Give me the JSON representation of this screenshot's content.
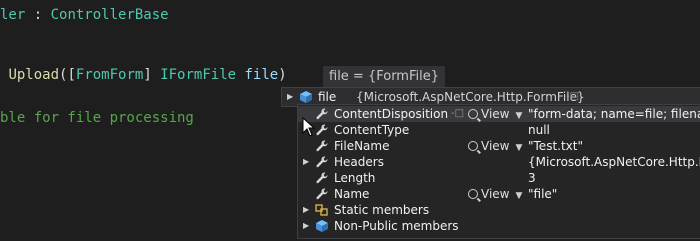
{
  "code": {
    "line1": {
      "class_suffix": "ler",
      "colon": " : ",
      "base": "ControllerBase"
    },
    "line2": {
      "method": "Upload",
      "open": "(",
      "attr_open": "[",
      "attr": "FromForm",
      "attr_close": "]",
      "type": "IFormFile",
      "param": "file",
      "close": ")"
    },
    "line3": {
      "comment": "ble for file processing"
    }
  },
  "inline_hint": "file = {FormFile}",
  "datatip": {
    "name": "file",
    "value": "{Microsoft.AspNetCore.Http.FormFile}",
    "icon": "object-icon"
  },
  "members": [
    {
      "name": "ContentDisposition",
      "value": "\"form-data; name=file; filename",
      "view": "View",
      "expandable": false,
      "icon": "wrench-icon",
      "selected": true
    },
    {
      "name": "ContentType",
      "value": "null",
      "view": "",
      "expandable": false,
      "icon": "wrench-icon",
      "selected": false
    },
    {
      "name": "FileName",
      "value": "\"Test.txt\"",
      "view": "View",
      "expandable": false,
      "icon": "wrench-icon",
      "selected": false
    },
    {
      "name": "Headers",
      "value": "{Microsoft.AspNetCore.Http.Hea",
      "view": "",
      "expandable": true,
      "icon": "wrench-icon",
      "selected": false
    },
    {
      "name": "Length",
      "value": "3",
      "view": "",
      "expandable": false,
      "icon": "wrench-icon",
      "selected": false
    },
    {
      "name": "Name",
      "value": "\"file\"",
      "view": "View",
      "expandable": false,
      "icon": "wrench-icon",
      "selected": false
    },
    {
      "name": "Static members",
      "value": "",
      "view": "",
      "expandable": true,
      "icon": "static-members-icon",
      "selected": false
    },
    {
      "name": "Non-Public members",
      "value": "",
      "view": "",
      "expandable": true,
      "icon": "non-public-members-icon",
      "selected": false
    }
  ],
  "colors": {
    "background": "#1e1e1e",
    "panel": "#252526",
    "type": "#4ec9b0",
    "method": "#dcdcaa",
    "param": "#9cdcfe",
    "comment": "#57a64a"
  }
}
